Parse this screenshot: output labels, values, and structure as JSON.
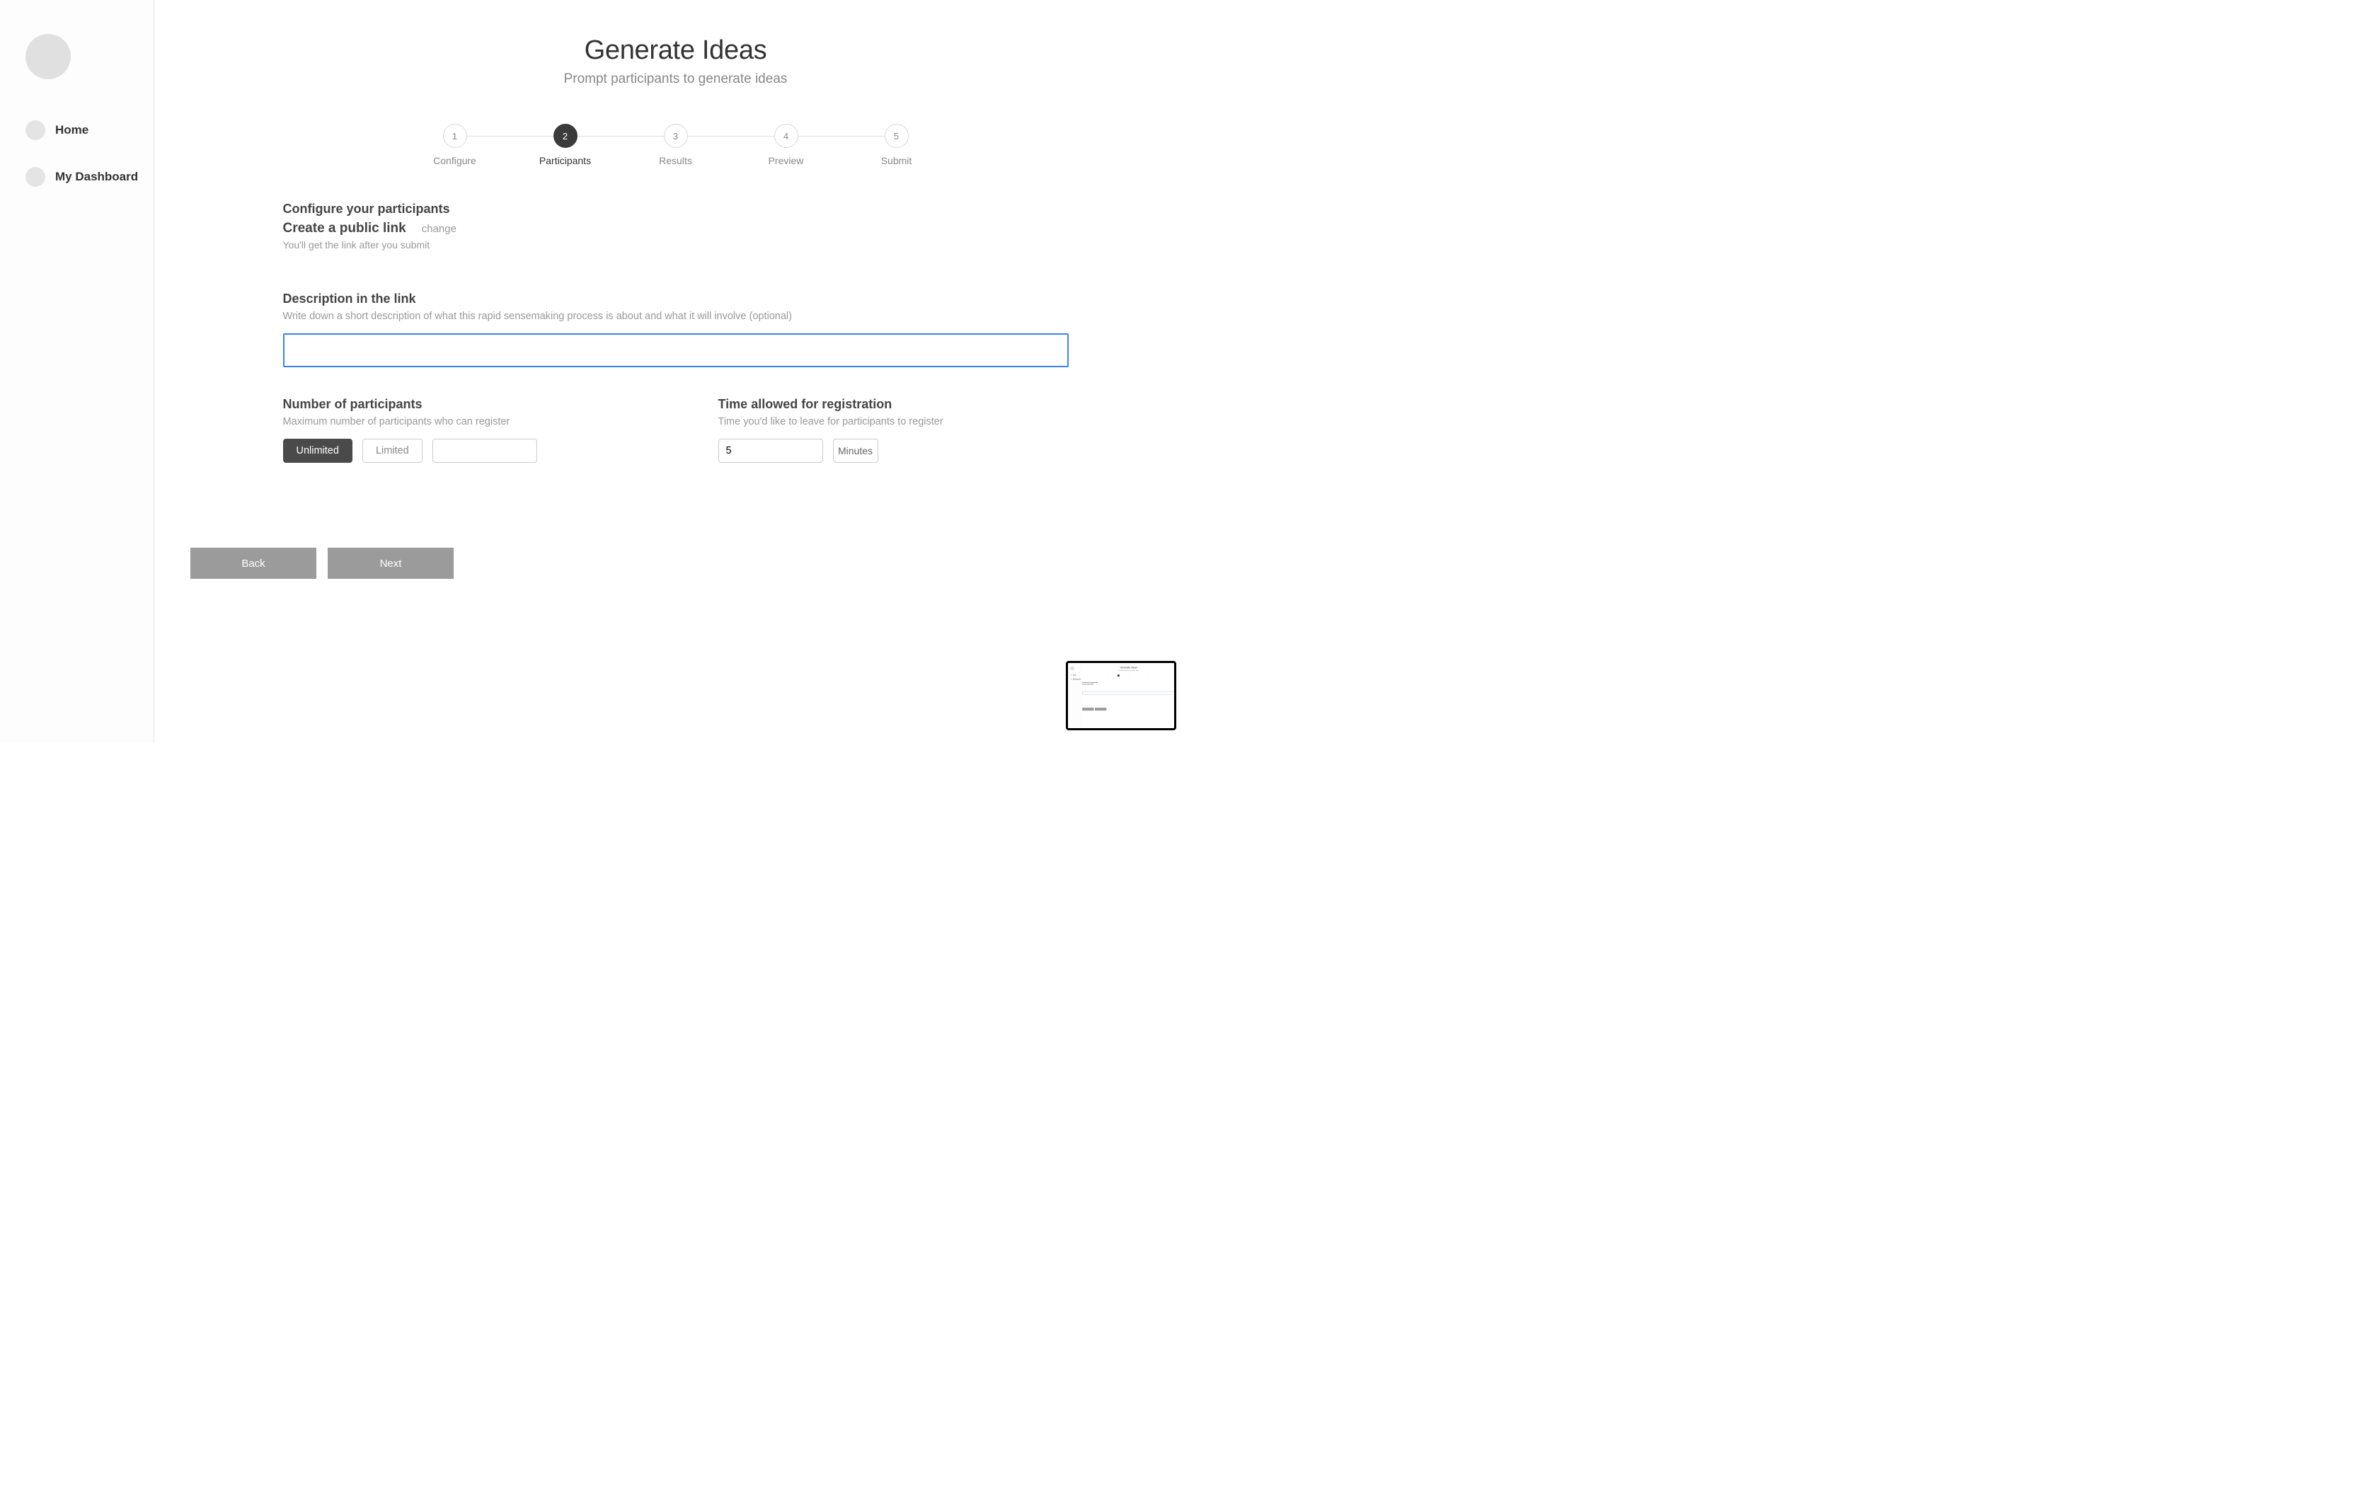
{
  "sidebar": {
    "items": [
      {
        "label": "Home"
      },
      {
        "label": "My Dashboard"
      }
    ]
  },
  "header": {
    "title": "Generate Ideas",
    "subtitle": "Prompt participants to generate ideas"
  },
  "stepper": {
    "steps": [
      {
        "num": "1",
        "label": "Configure"
      },
      {
        "num": "2",
        "label": "Participants"
      },
      {
        "num": "3",
        "label": "Results"
      },
      {
        "num": "4",
        "label": "Preview"
      },
      {
        "num": "5",
        "label": "Submit"
      }
    ],
    "active_index": 1
  },
  "form": {
    "configure_heading": "Configure your participants",
    "link_heading": "Create a public link",
    "change_label": "change",
    "link_help": "You'll get the link after you submit",
    "description": {
      "title": "Description in the link",
      "sub": "Write down a short description of what this rapid sensemaking process is about and what it will involve (optional)",
      "value": ""
    },
    "participants": {
      "title": "Number of participants",
      "sub": "Maximum number of participants who can register",
      "unlimited_label": "Unlimited",
      "limited_label": "Limited",
      "limit_value": ""
    },
    "time": {
      "title": "Time allowed for registration",
      "sub": "Time you'd like to leave for participants to register",
      "value": "5",
      "unit": "Minutes"
    }
  },
  "footer": {
    "back": "Back",
    "next": "Next"
  }
}
